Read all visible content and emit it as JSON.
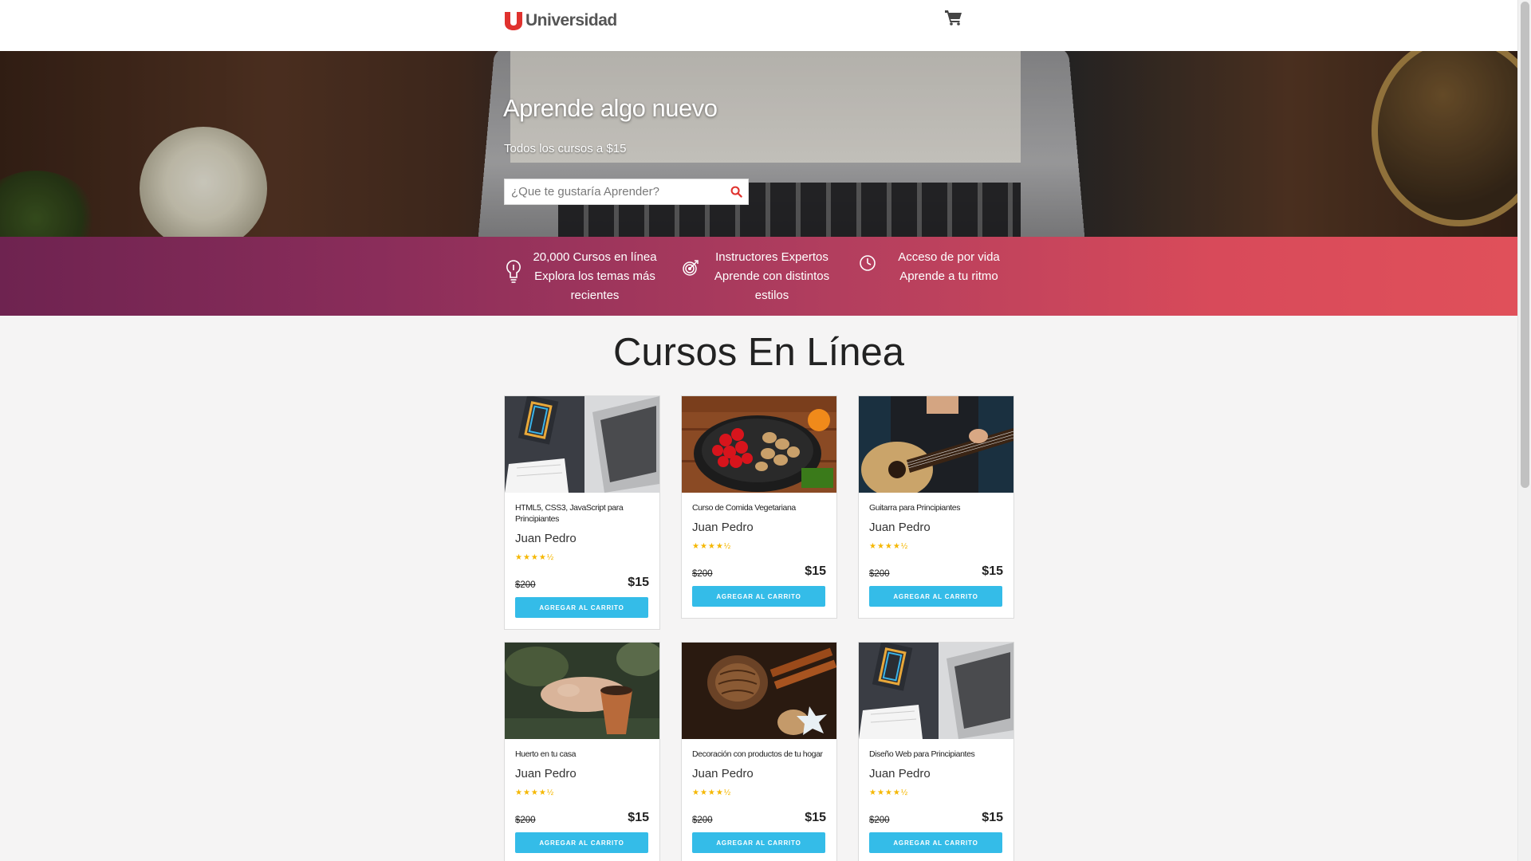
{
  "brand": {
    "name": "Universidad",
    "logo_letter": "U",
    "accent": "#e0322e"
  },
  "header": {
    "cart_icon": "shopping-cart-icon"
  },
  "hero": {
    "title": "Aprende algo nuevo",
    "subtitle": "Todos los cursos a $15",
    "search_placeholder": "¿Que te gustaría Aprender?",
    "search_icon": "search-icon"
  },
  "features": [
    {
      "icon": "lightbulb-icon",
      "line1": "20,000 Cursos en línea",
      "line2": "Explora los temas más",
      "line3": "recientes"
    },
    {
      "icon": "target-icon",
      "line1": "Instructores Expertos",
      "line2": "Aprende con distintos",
      "line3": "estilos"
    },
    {
      "icon": "clock-icon",
      "line1": "Acceso de por vida",
      "line2": "Aprende a tu ritmo",
      "line3": ""
    }
  ],
  "section": {
    "title": "Cursos En Línea"
  },
  "courses": [
    {
      "title": "HTML5, CSS3, JavaScript para Principiantes",
      "author": "Juan Pedro",
      "stars": "★★★★½",
      "rating": 4.5,
      "old_price": "$200",
      "price": "$15",
      "button": "AGREGAR AL CARRITO",
      "image": "laptop-notebook-image"
    },
    {
      "title": "Curso de Comida Vegetariana",
      "author": "Juan Pedro",
      "stars": "★★★★½",
      "rating": 4.5,
      "old_price": "$200",
      "price": "$15",
      "button": "AGREGAR AL CARRITO",
      "image": "vegetables-pan-image"
    },
    {
      "title": "Guitarra para Principiantes",
      "author": "Juan Pedro",
      "stars": "★★★★½",
      "rating": 4.5,
      "old_price": "$200",
      "price": "$15",
      "button": "AGREGAR AL CARRITO",
      "image": "guitar-player-image"
    },
    {
      "title": "Huerto en tu casa",
      "author": "Juan Pedro",
      "stars": "★★★★½",
      "rating": 4.5,
      "old_price": "$200",
      "price": "$15",
      "button": "AGREGAR AL CARRITO",
      "image": "plant-pot-image"
    },
    {
      "title": "Decoración con productos de tu hogar",
      "author": "Juan Pedro",
      "stars": "★★★★½",
      "rating": 4.5,
      "old_price": "$200",
      "price": "$15",
      "button": "AGREGAR AL CARRITO",
      "image": "pinecones-cinnamon-image"
    },
    {
      "title": "Diseño Web para Principiantes",
      "author": "Juan Pedro",
      "stars": "★★★★½",
      "rating": 4.5,
      "old_price": "$200",
      "price": "$15",
      "button": "AGREGAR AL CARRITO",
      "image": "laptop-notebook-image"
    }
  ],
  "colors": {
    "button": "#34bce8",
    "stars": "#f5b700",
    "gradient_start": "#6e2350",
    "gradient_end": "#e0505a"
  }
}
